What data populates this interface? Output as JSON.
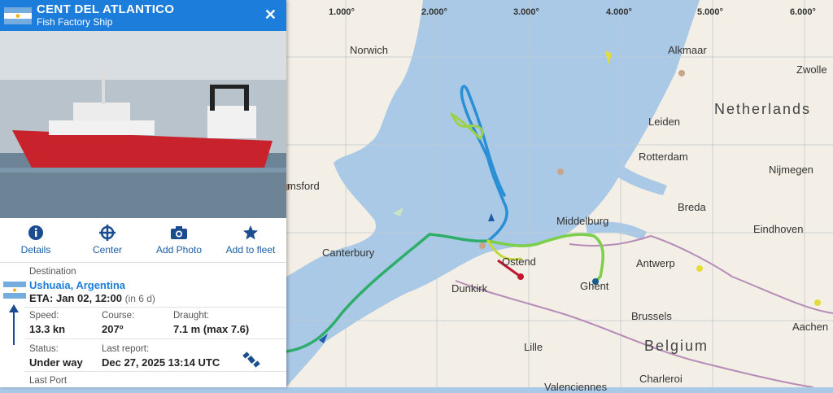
{
  "vessel": {
    "name": "CENT DEL ATLANTICO",
    "type": "Fish Factory Ship",
    "flag_icon": "argentina-flag-icon"
  },
  "actions": [
    {
      "label": "Details",
      "icon": "info-icon"
    },
    {
      "label": "Center",
      "icon": "crosshair-icon"
    },
    {
      "label": "Add Photo",
      "icon": "camera-icon"
    },
    {
      "label": "Add to fleet",
      "icon": "star-icon"
    }
  ],
  "voyage": {
    "destination_label": "Destination",
    "destination": "Ushuaia, Argentina",
    "eta_label": "ETA:",
    "eta": "Jan 02, 12:00",
    "eta_relative": "(in 6 d)"
  },
  "stats": {
    "speed_label": "Speed:",
    "speed": "13.3 kn",
    "course_label": "Course:",
    "course": "207º",
    "draught_label": "Draught:",
    "draught": "7.1 m (max 7.6)",
    "status_label": "Status:",
    "status": "Under way",
    "report_label": "Last report:",
    "report": "Dec 27, 2025 13:14 UTC",
    "last_port_label": "Last Port"
  },
  "map": {
    "longitudes": [
      "1.000°",
      "2.000°",
      "3.000°",
      "4.000°",
      "5.000°",
      "6.000°"
    ],
    "places": [
      "Norwich",
      "Alkmaar",
      "Zwolle",
      "Leiden",
      "Rotterdam",
      "Nijmegen",
      "Breda",
      "Eindhoven",
      "Middelburg",
      "Antwerp",
      "Ostend",
      "Ghent",
      "Brussels",
      "Dunkirk",
      "Canterbury",
      "msford",
      "Lille",
      "Charleroi",
      "Aachen",
      "Valenciennes"
    ],
    "countries": [
      "Netherlands",
      "Belgium"
    ],
    "colors": {
      "sea": "#aac9e6",
      "land": "#f3efe6",
      "track_green": "#2fae6b",
      "track_blue": "#2b8fd6",
      "header": "#1c7ddb"
    }
  }
}
